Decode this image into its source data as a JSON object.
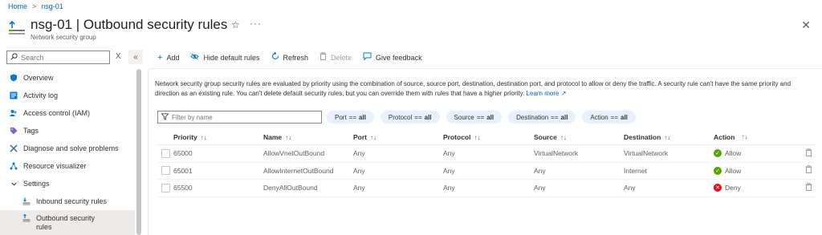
{
  "breadcrumb": {
    "home": "Home",
    "separator": ">",
    "current": "nsg-01"
  },
  "header": {
    "title": "nsg-01 | Outbound security rules",
    "subtitle": "Network security group",
    "star_icon": "star-icon",
    "more_label": "···",
    "close_label": "✕"
  },
  "sidebar": {
    "search_placeholder": "Search",
    "clear_label": "X",
    "collapse_label": "«",
    "items": [
      {
        "label": "Overview",
        "icon": "shield-icon"
      },
      {
        "label": "Activity log",
        "icon": "activity-log-icon"
      },
      {
        "label": "Access control (IAM)",
        "icon": "people-icon"
      },
      {
        "label": "Tags",
        "icon": "tag-icon"
      },
      {
        "label": "Diagnose and solve problems",
        "icon": "wrench-icon"
      },
      {
        "label": "Resource visualizer",
        "icon": "visualizer-icon"
      },
      {
        "label": "Settings",
        "icon": "chevron-down-icon"
      },
      {
        "label": "Inbound security rules",
        "icon": "inbound-icon"
      },
      {
        "label": "Outbound security rules",
        "icon": "outbound-icon",
        "selected": true
      }
    ]
  },
  "toolbar": {
    "add": "Add",
    "hide_default": "Hide default rules",
    "refresh": "Refresh",
    "delete": "Delete",
    "feedback": "Give feedback"
  },
  "description": {
    "text": "Network security group security rules are evaluated by priority using the combination of source, source port, destination, destination port, and protocol to allow or deny the traffic. A security rule can't have the same priority and direction as an existing rule. You can't delete default security rules, but you can override them with rules that have a higher priority.",
    "link": "Learn more"
  },
  "filter": {
    "placeholder": "Filter by name",
    "pills": [
      {
        "key": "Port",
        "op": "==",
        "value": "all"
      },
      {
        "key": "Protocol",
        "op": "==",
        "value": "all"
      },
      {
        "key": "Source",
        "op": "==",
        "value": "all"
      },
      {
        "key": "Destination",
        "op": "==",
        "value": "all"
      },
      {
        "key": "Action",
        "op": "==",
        "value": "all"
      }
    ]
  },
  "table": {
    "columns": [
      "Priority",
      "Name",
      "Port",
      "Protocol",
      "Source",
      "Destination",
      "Action"
    ],
    "rows": [
      {
        "priority": "65000",
        "name": "AllowVnetOutBound",
        "port": "Any",
        "protocol": "Any",
        "source": "VirtualNetwork",
        "destination": "VirtualNetwork",
        "action": "Allow"
      },
      {
        "priority": "65001",
        "name": "AllowInternetOutBound",
        "port": "Any",
        "protocol": "Any",
        "source": "Any",
        "destination": "Internet",
        "action": "Allow"
      },
      {
        "priority": "65500",
        "name": "DenyAllOutBound",
        "port": "Any",
        "protocol": "Any",
        "source": "Any",
        "destination": "Any",
        "action": "Deny"
      }
    ]
  },
  "colors": {
    "accent": "#0078d4",
    "allow": "#57a300",
    "deny": "#e00b1c",
    "pill_bg": "#e8f1fb"
  }
}
